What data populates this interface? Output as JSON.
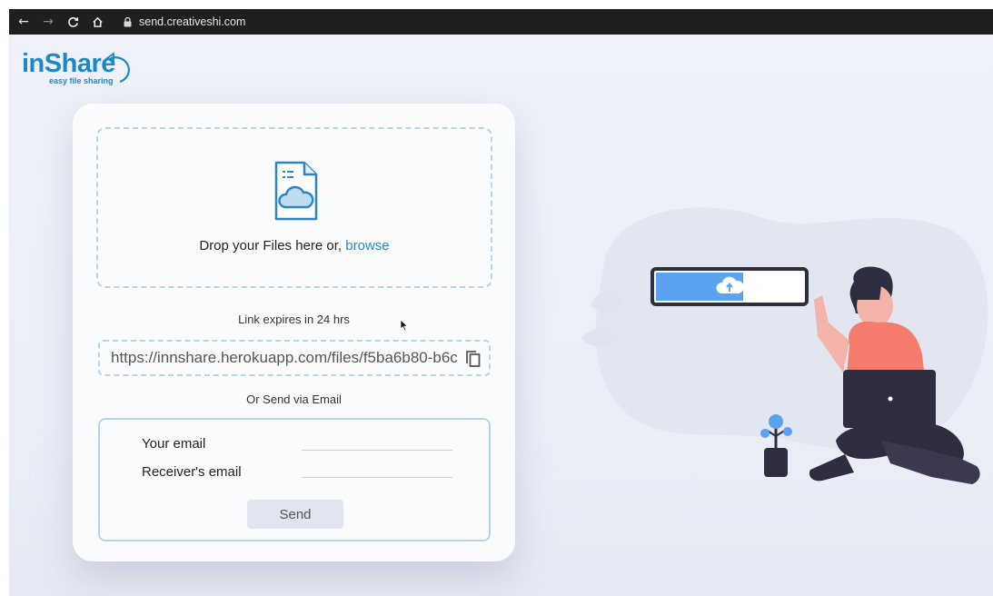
{
  "browser": {
    "url": "send.creativeshi.com",
    "back_icon": "arrow-left-icon",
    "forward_icon": "arrow-right-icon",
    "reload_icon": "reload-icon",
    "home_icon": "home-icon",
    "lock_icon": "lock-icon"
  },
  "logo": {
    "title": "inShare",
    "tagline": "easy file sharing"
  },
  "dropzone": {
    "text": "Drop your Files here or,",
    "browse_label": "browse",
    "icon": "file-cloud-icon"
  },
  "share": {
    "expiry_text": "Link expires in 24 hrs",
    "link_value": "https://innshare.herokuapp.com/files/f5ba6b80-b6c",
    "copy_icon": "copy-icon"
  },
  "email": {
    "heading": "Or Send via Email",
    "sender_label": "Your email",
    "receiver_label": "Receiver's email",
    "send_label": "Send"
  },
  "colors": {
    "brand": "#1e88c7",
    "dashed_border": "#b6d4ec",
    "upload_bar": "#5ba2f0"
  }
}
